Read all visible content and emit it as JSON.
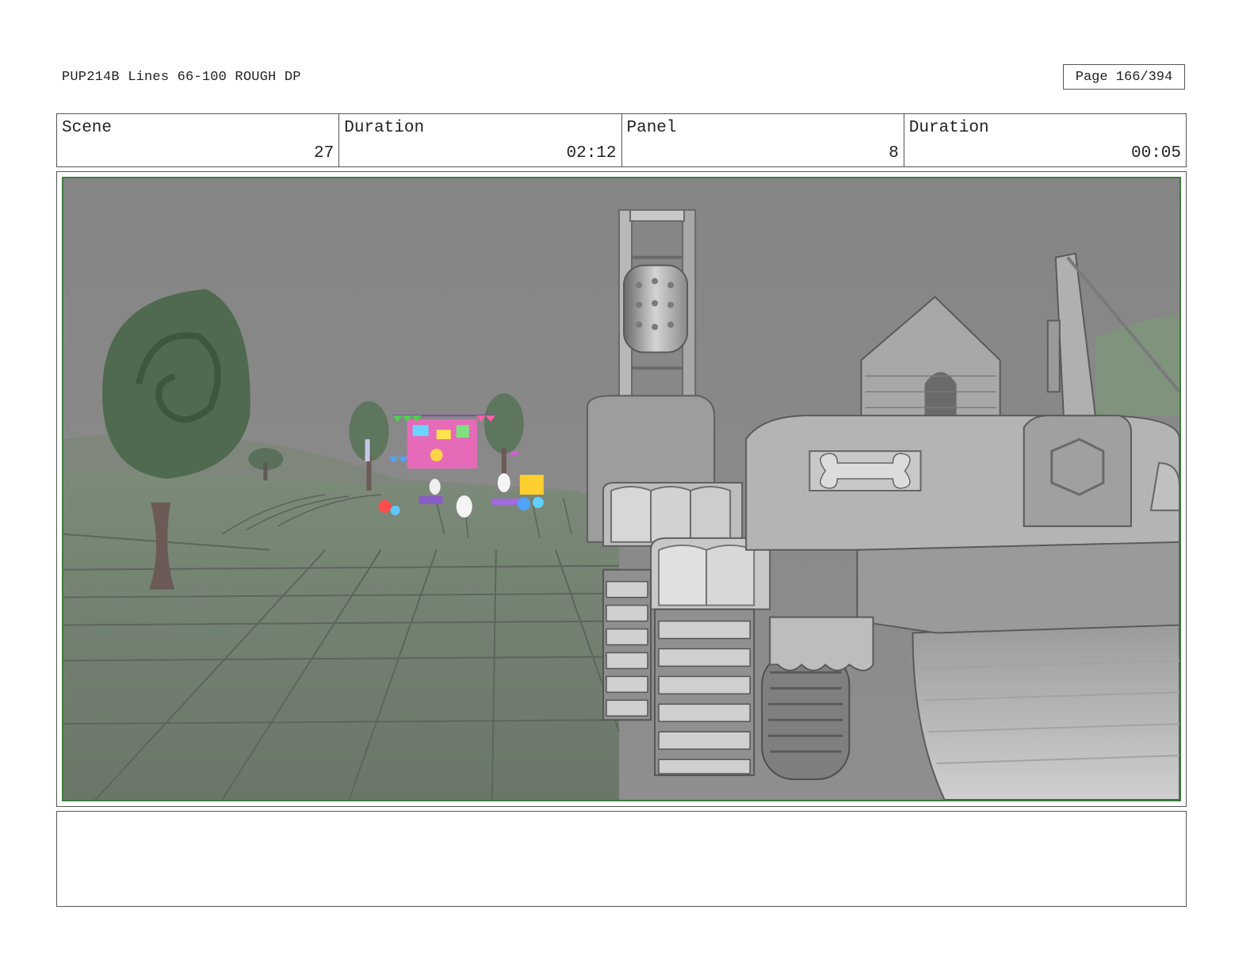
{
  "header": {
    "title": "PUP214B Lines 66-100 ROUGH DP",
    "page": "Page 166/394"
  },
  "info": {
    "scene_label": "Scene",
    "scene_value": "27",
    "scene_duration_label": "Duration",
    "scene_duration_value": "02:12",
    "panel_label": "Panel",
    "panel_value": "8",
    "panel_duration_label": "Duration",
    "panel_duration_value": "00:05"
  },
  "notes": "",
  "colors": {
    "frame_border": "#3f7a3f",
    "sky": "#8a8a8a",
    "ground": "#6f7a6e",
    "tree": "#4d6a4d"
  }
}
